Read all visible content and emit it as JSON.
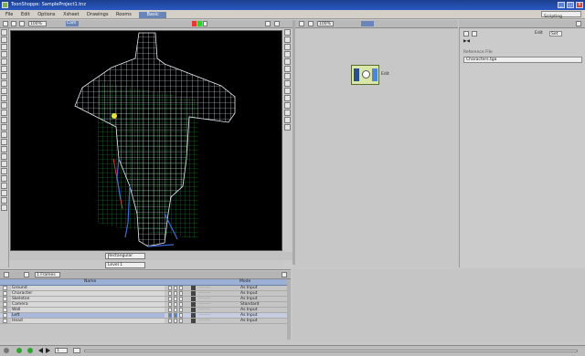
{
  "window": {
    "title": "ToonShoppe: SampleProject1.tnz"
  },
  "menu": {
    "items": [
      "File",
      "Edit",
      "Options",
      "Xsheet",
      "Drawings",
      "Rooms"
    ],
    "active_room": "Basic",
    "right_label": "Scripting"
  },
  "viewport": {
    "toolbar_zoom": "100%",
    "camera_label": "Cam",
    "scene_dropdown": "Rectangular",
    "frame_dropdown": "Level 1"
  },
  "schematic": {
    "zoom": "100%",
    "node_label": "Edit"
  },
  "properties": {
    "tabs": [
      "Edit",
      "Set"
    ],
    "field_label": "Reference File",
    "field_value": "Characters.tga"
  },
  "xsheet": {
    "frame_label": "1 Frames",
    "header_name": "Name",
    "header_mode": "Mode",
    "rows": [
      {
        "name": "Ground",
        "ink": "--------",
        "mode": "As Input"
      },
      {
        "name": "Character",
        "ink": "--------",
        "mode": "As Input"
      },
      {
        "name": "Skeleton",
        "ink": "--------",
        "mode": "As Input"
      },
      {
        "name": "Camera",
        "ink": "--------",
        "mode": "Standard"
      },
      {
        "name": "Wall",
        "ink": "--------",
        "mode": "As Input"
      },
      {
        "name": "Left",
        "ink": "--------",
        "mode": "As Input"
      },
      {
        "name": "Head",
        "ink": "--------",
        "mode": "As Input"
      }
    ]
  },
  "statusbar": {
    "frame": "1"
  },
  "colors": {
    "title_bg": "#1c3f8f",
    "accent": "#9bb0d4",
    "node_bg": "#d8e6a8",
    "mesh_white": "#e8eef7",
    "mesh_blue": "#3f6bd9",
    "grid_green": "#2ecc4a"
  }
}
